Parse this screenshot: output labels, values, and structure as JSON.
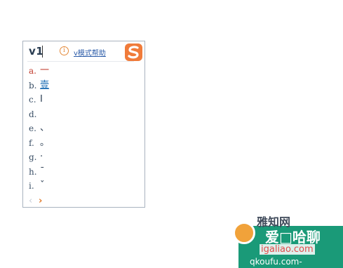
{
  "ime": {
    "composition": "v1",
    "help_link": "v模式帮助",
    "info_icon": "info-icon",
    "logo_icon": "sogou-s-logo-icon",
    "candidates": [
      {
        "key": "a.",
        "text": "一",
        "highlight": true
      },
      {
        "key": "b.",
        "text": "壹",
        "link": true
      },
      {
        "key": "c.",
        "text": "Ⅰ"
      },
      {
        "key": "d.",
        "text": ""
      },
      {
        "key": "e.",
        "text": "、"
      },
      {
        "key": "f.",
        "text": "。"
      },
      {
        "key": "g.",
        "text": "·"
      },
      {
        "key": "h.",
        "text": "ˉ"
      },
      {
        "key": "i.",
        "text": "ˇ"
      }
    ],
    "pager": {
      "prev": "‹",
      "next": "›"
    }
  },
  "watermark": {
    "line1": "雅知网",
    "line2": "爱□哈聊",
    "line3": "igaliao.com",
    "line4": "qkoufu.com-"
  },
  "colors": {
    "accent": "#e07a2a",
    "highlight": "#c0392b",
    "link": "#1f6fb5",
    "border": "#a9b3bf",
    "watermark_green": "#1a9a78"
  }
}
